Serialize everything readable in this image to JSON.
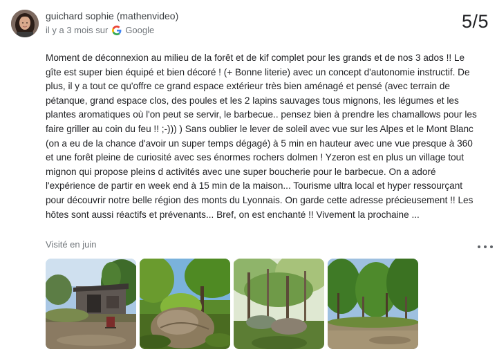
{
  "review": {
    "author_name": "guichard sophie (mathenvideo)",
    "time_ago": "il y a 3 mois sur",
    "source": "Google",
    "rating": "5/5",
    "text": "Moment de déconnexion au milieu de la forêt et de kif complet pour les grands et de nos 3 ados !! Le gîte est super bien équipé et bien décoré ! (+ Bonne literie) avec un concept d'autonomie instructif. De plus, il y a tout ce qu'offre ce grand espace extérieur très bien aménagé et pensé (avec terrain de pétanque, grand espace clos, des poules et les 2 lapins sauvages tous mignons, les légumes et les plantes aromatiques où l'on peut se servir, le barbecue.. pensez bien à prendre les chamallows pour les faire griller au coin du feu !! ;-))) ) Sans oublier le lever de soleil avec vue sur les Alpes et le Mont Blanc (on a eu de la chance d'avoir un super temps dégagé) à 5 min en hauteur avec une vue presque à 360 et une forêt pleine de curiosité avec ses énormes rochers dolmen ! Yzeron est en plus un village tout mignon qui propose pleins d activités avec une super boucherie pour le barbecue. On a adoré l'expérience de partir en week end à 15 min de la maison... Tourisme ultra local et hyper ressourçant pour découvrir notre belle région des monts du Lyonnais. On garde cette adresse précieusement !! Les hôtes sont aussi réactifs et prévenants... Bref, on est enchanté !! Vivement la prochaine ...",
    "visited": "Visité en juin"
  },
  "icons": {
    "google": "google-g-icon",
    "more": "more-horizontal-icon"
  },
  "photos": [
    {
      "name": "photo-cabin"
    },
    {
      "name": "photo-boulder"
    },
    {
      "name": "photo-forest-path"
    },
    {
      "name": "photo-forest-clearing"
    }
  ]
}
